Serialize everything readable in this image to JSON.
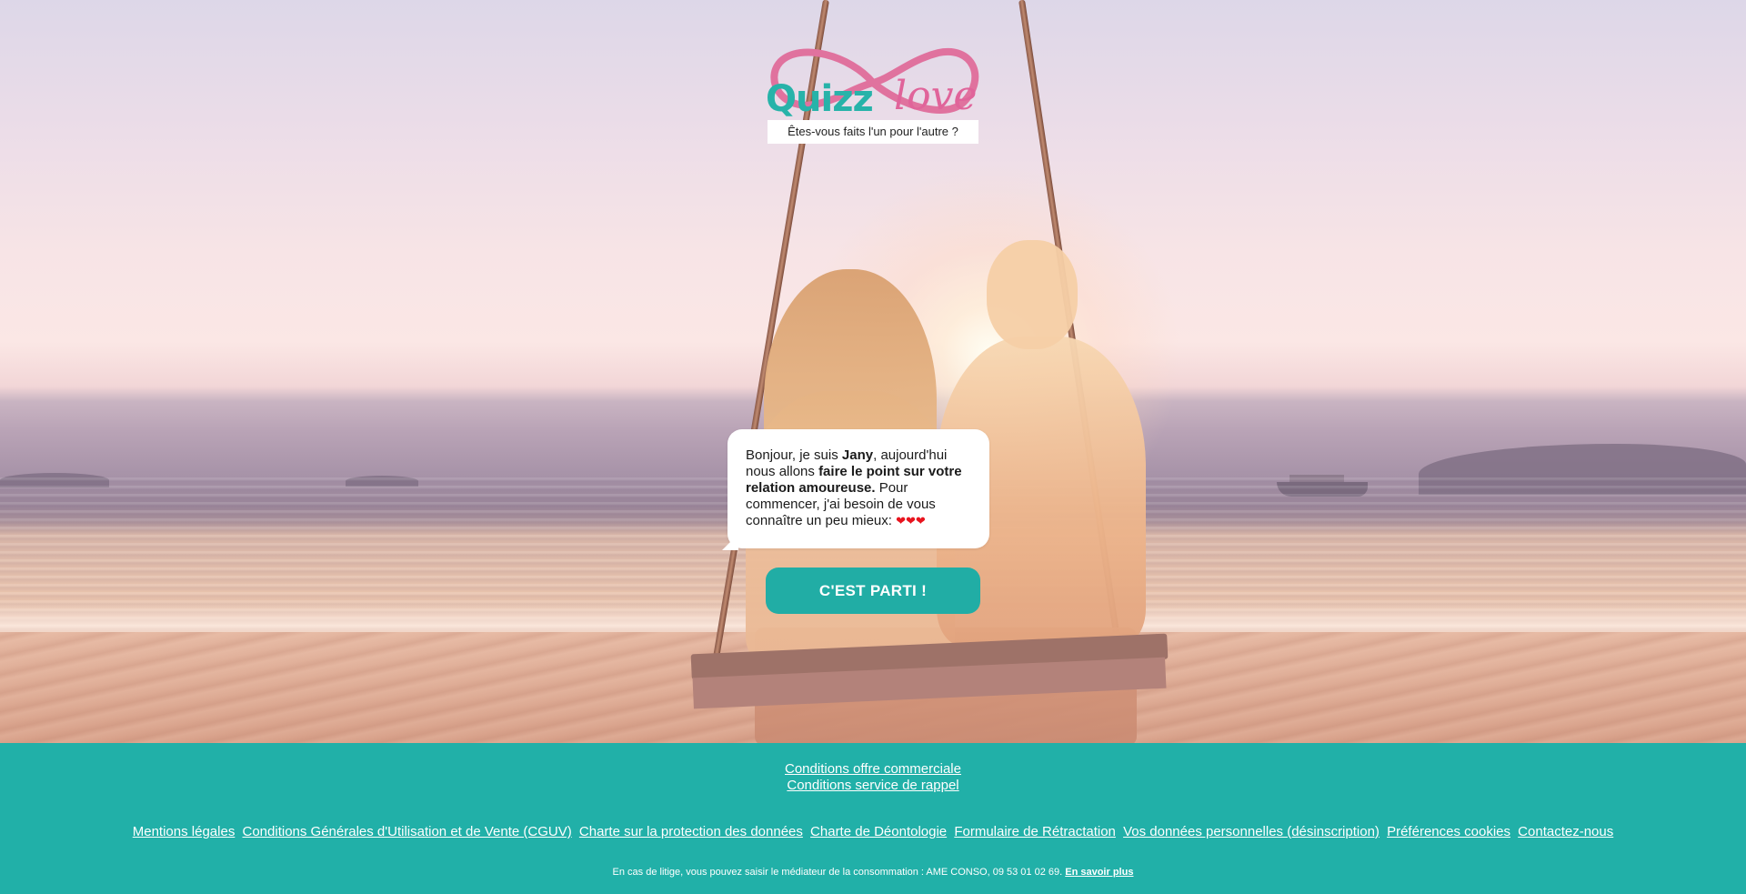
{
  "brand": {
    "logo_text_quizz": "Quizz",
    "logo_text_love": "love",
    "tagline": "Êtes-vous faits l'un pour l'autre ?"
  },
  "bubble": {
    "part1": "Bonjour, je suis ",
    "name": "Jany",
    "part2": ", aujourd'hui nous allons ",
    "bold_phrase": "faire le point sur votre relation amoureuse.",
    "part3": " Pour commencer, j'ai besoin de vous connaître un peu mieux: ",
    "hearts": "❤❤❤"
  },
  "cta": {
    "label": "C'EST PARTI !"
  },
  "footer": {
    "offer_links": [
      "Conditions offre commerciale",
      "Conditions service de rappel"
    ],
    "legal_links": [
      "Mentions légales",
      "Conditions Générales d'Utilisation et de Vente (CGUV)",
      "Charte sur la protection des données",
      "Charte de Déontologie",
      "Formulaire de Rétractation",
      "Vos données personnelles (désinscription)",
      "Préférences cookies",
      "Contactez-nous"
    ],
    "mediator_text": "En cas de litige, vous pouvez saisir le médiateur de la consommation : AME CONSO, 09 53 01 02 69.",
    "mediator_link": "En savoir plus"
  },
  "colors": {
    "teal": "#21b0a8",
    "pink": "#e0649a",
    "heart_red": "#e8141e"
  }
}
